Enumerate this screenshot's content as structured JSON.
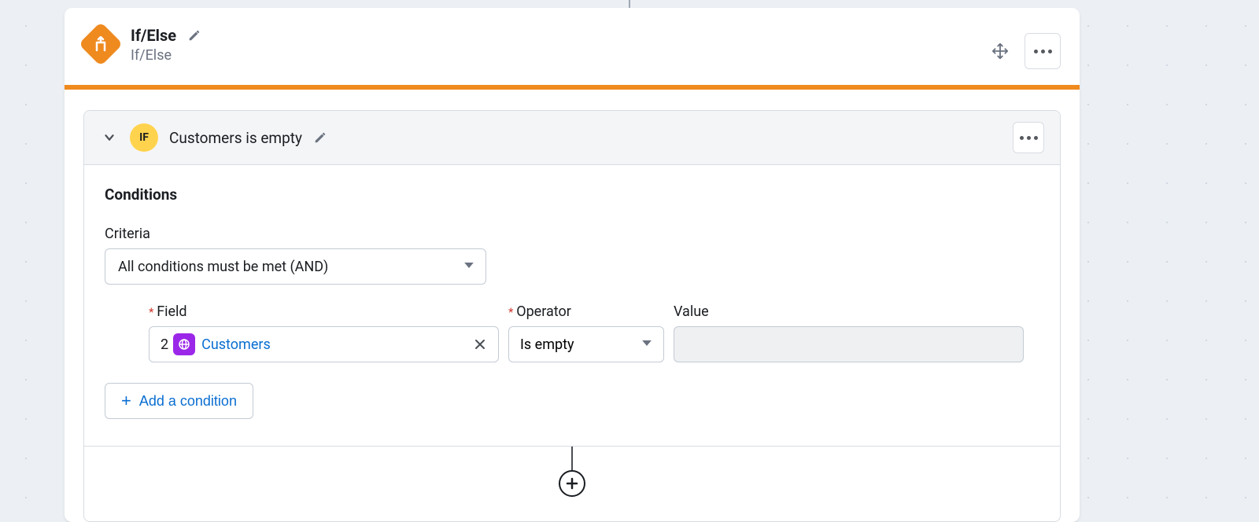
{
  "node": {
    "title": "If/Else",
    "subtitle": "If/Else"
  },
  "branch": {
    "badge": "IF",
    "name": "Customers is empty"
  },
  "sections": {
    "conditions_label": "Conditions",
    "criteria_label": "Criteria",
    "criteria_value": "All conditions must be met (AND)"
  },
  "columns": {
    "field": "Field",
    "operator": "Operator",
    "value": "Value"
  },
  "condition_row": {
    "index": "2",
    "field_name": "Customers",
    "operator": "Is empty",
    "value": ""
  },
  "buttons": {
    "add_condition": "Add a condition"
  }
}
